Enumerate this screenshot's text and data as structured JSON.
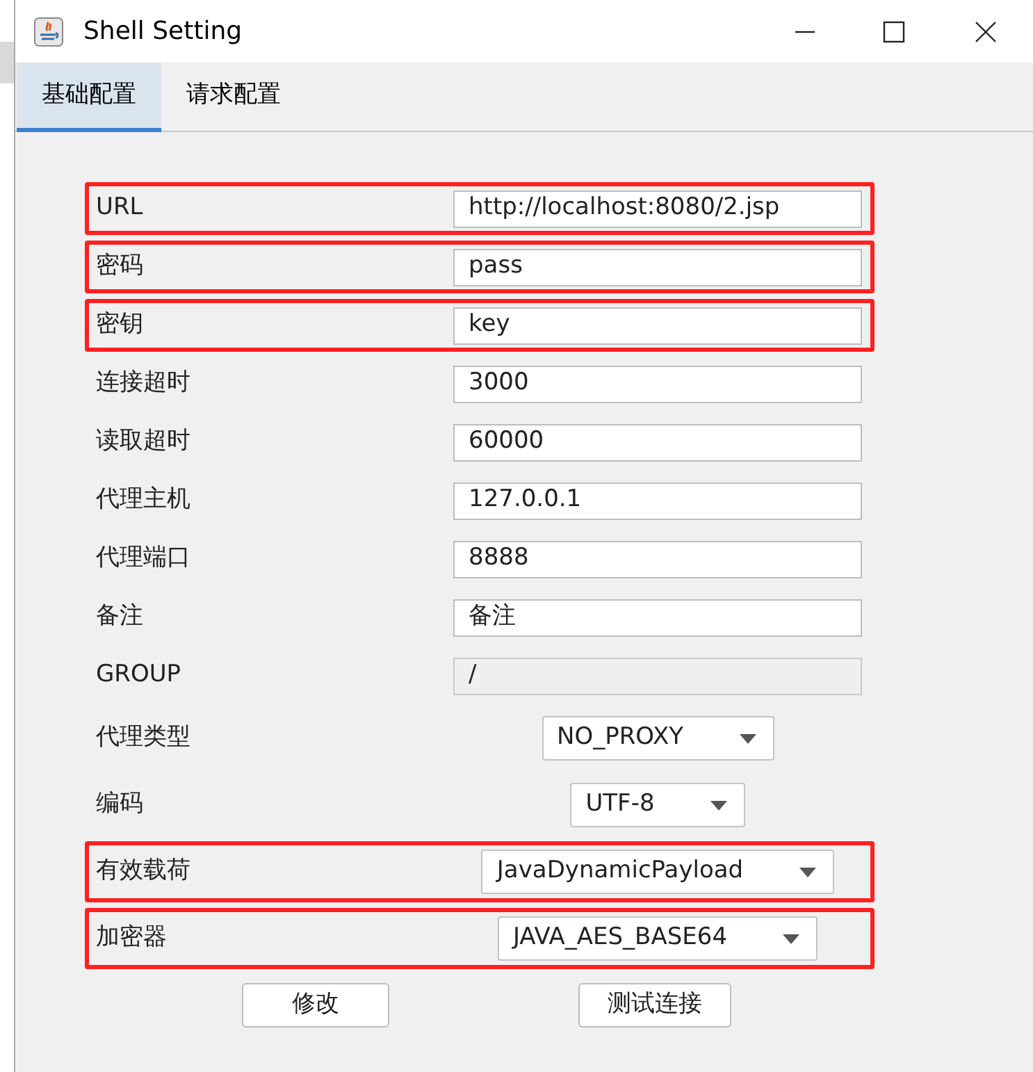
{
  "window": {
    "title": "Shell Setting"
  },
  "tabs": [
    {
      "label": "基础配置",
      "selected": true
    },
    {
      "label": "请求配置",
      "selected": false
    }
  ],
  "fields": [
    {
      "kind": "text",
      "label": "URL",
      "value": "http://localhost:8080/2.jsp",
      "disabled": false,
      "highlighted": true
    },
    {
      "kind": "text",
      "label": "密码",
      "value": "pass",
      "disabled": false,
      "highlighted": true
    },
    {
      "kind": "text",
      "label": "密钥",
      "value": "key",
      "disabled": false,
      "highlighted": true
    },
    {
      "kind": "text",
      "label": "连接超时",
      "value": "3000",
      "disabled": false,
      "highlighted": false
    },
    {
      "kind": "text",
      "label": "读取超时",
      "value": "60000",
      "disabled": false,
      "highlighted": false
    },
    {
      "kind": "text",
      "label": "代理主机",
      "value": "127.0.0.1",
      "disabled": false,
      "highlighted": false
    },
    {
      "kind": "text",
      "label": "代理端口",
      "value": "8888",
      "disabled": false,
      "highlighted": false
    },
    {
      "kind": "text",
      "label": "备注",
      "value": "备注",
      "disabled": false,
      "highlighted": false
    },
    {
      "kind": "text",
      "label": "GROUP",
      "value": "/",
      "disabled": true,
      "highlighted": false
    },
    {
      "kind": "dropdown",
      "label": "代理类型",
      "value": "NO_PROXY",
      "highlighted": false
    },
    {
      "kind": "dropdown",
      "label": "编码",
      "value": "UTF-8",
      "highlighted": false
    },
    {
      "kind": "dropdown",
      "label": "有效载荷",
      "value": "JavaDynamicPayload",
      "highlighted": true
    },
    {
      "kind": "dropdown",
      "label": "加密器",
      "value": "JAVA_AES_BASE64",
      "highlighted": true
    }
  ],
  "buttons": [
    "修改",
    "测试连接"
  ]
}
